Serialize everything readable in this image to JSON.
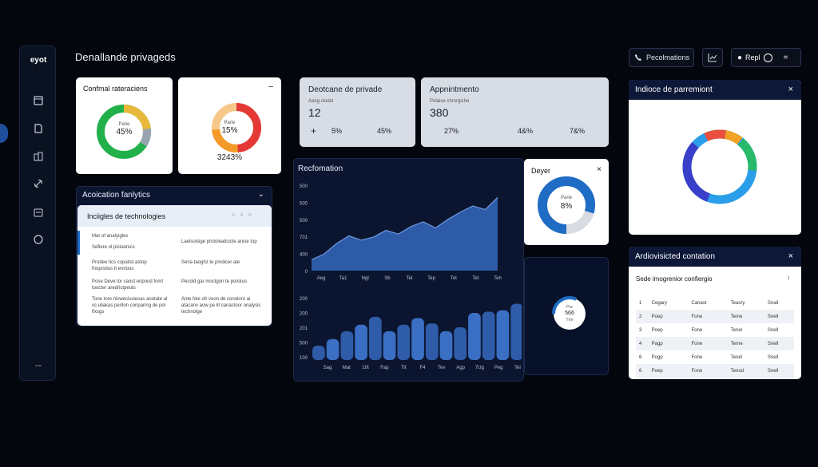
{
  "header": {
    "logo": "eyot",
    "title": "Denallande privageds",
    "recommend_label": "Pecolmations",
    "account_label": "Repl"
  },
  "sidebar": {
    "icons": [
      "calendar-icon",
      "document-icon",
      "building-icon",
      "link-icon",
      "inbox-icon",
      "circle-icon"
    ],
    "bottom": "--"
  },
  "card_conformal": {
    "title": "Confmal rateraciens",
    "donut_sub": "Parie",
    "donut_value": "45%",
    "colors": [
      "#22b04a",
      "#e8b83a",
      "#9aa4b0"
    ]
  },
  "card_ring2": {
    "close": "–",
    "donut_sub": "Parie",
    "donut_value": "15%",
    "value": "3243%",
    "colors": [
      "#e53935",
      "#f39a28",
      "#f6c98a"
    ]
  },
  "card_privade": {
    "title": "Deotcane de privade",
    "sub": "Aang clodol",
    "value": "12",
    "plus": "+",
    "metric1": "5%",
    "metric2": "45%"
  },
  "card_appointment": {
    "title": "Appnintmento",
    "sub": "Polaice chrorgiche",
    "value": "380",
    "metric1": "27%",
    "metric2": "4&%",
    "metric3": "7&%"
  },
  "card_indice": {
    "title": "Indioce de parremiont",
    "close": "×"
  },
  "analytics": {
    "title": "Acoication fanlytics",
    "inner_title": "Inciigles de technologies",
    "col1": [
      "Mar of analyigles",
      "Sefiere ol pistaonics",
      "Prodee tics copatist\nastop fnoprstios tt enrious",
      "Pose Deve tor caost enpood\nfomt toocter aredrictpeuts",
      "Tone tore nivwecissiesas\nanotate al vs uliakas perilon\nconparing de pol fixsgs"
    ],
    "col2": [
      "Laelsolsige protoleaticicte ancie\ntop",
      "Sena taogfst te pmdicer ale",
      "Pecold gar moctgon te poiskus",
      "Ante fole ofr voon de conoloro\nai atacanv aow pe lit canactoor\nonalysis technolge"
    ]
  },
  "recommendation": {
    "title": "Recfomation",
    "area_y_ticks": [
      "500",
      "500",
      "500",
      "701",
      "400",
      "0"
    ],
    "area_x_labels": [
      "Aeg",
      "Ta1",
      "Ngt",
      "Sb",
      "Tet",
      "Tep",
      "Tet",
      "Tet",
      "Teh"
    ],
    "bar_y_ticks": [
      "200",
      "200",
      "201",
      "500",
      "100"
    ],
    "bar_x_labels": [
      "Sag",
      "Mat",
      "10t",
      "Fap",
      "Tit",
      "F4",
      "Tev",
      "Agp",
      "7Ug",
      "Peg",
      "Tei"
    ]
  },
  "card_dayer": {
    "title": "Deyer",
    "close": "×",
    "donut_sub": "Parie",
    "donut_value": "8%",
    "color": "#1f6cc4"
  },
  "small_donut": {
    "sub": "Pre",
    "value": "566",
    "sub2": "Ttre"
  },
  "contation": {
    "title": "Ardiovisicted contation",
    "close": "×",
    "subtitle": "Sede imogrenior confiergio",
    "sort_icon": "↕",
    "headers": [
      "1",
      "Cegary",
      "Canast",
      "Teasry",
      "Snall"
    ],
    "rows": [
      [
        "2",
        "Poep",
        "Fone",
        "Teme",
        "Snell"
      ],
      [
        "3",
        "Poep",
        "Fone",
        "Tenel",
        "Snell"
      ],
      [
        "4",
        "Pagp",
        "Fone",
        "Terne",
        "Snell"
      ],
      [
        "6",
        "Pogp",
        "Fone",
        "Tenel",
        "Snell"
      ],
      [
        "6",
        "Poep",
        "Fone",
        "Tenod",
        "Snell"
      ]
    ]
  },
  "chart_data": [
    {
      "type": "area",
      "title": "Recfomation",
      "categories": [
        "Aeg",
        "Ta1",
        "Ngt",
        "Sb",
        "Tet",
        "Tep",
        "Tet",
        "Tet",
        "Teh"
      ],
      "values": [
        90,
        135,
        220,
        285,
        250,
        275,
        330,
        300,
        360,
        400,
        350,
        420,
        480,
        530,
        500,
        600
      ],
      "ylim": [
        0,
        700
      ]
    },
    {
      "type": "bar",
      "categories": [
        "Sag",
        "Mat",
        "10t",
        "Fap",
        "Tit",
        "F4",
        "Tev",
        "Agp",
        "7Ug",
        "Peg",
        "Tei"
      ],
      "values": [
        55,
        80,
        110,
        135,
        165,
        110,
        135,
        160,
        140,
        110,
        125,
        180,
        185,
        190,
        215
      ],
      "ylim": [
        0,
        250
      ]
    }
  ]
}
